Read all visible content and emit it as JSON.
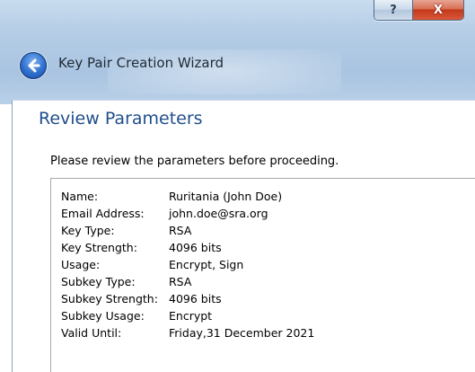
{
  "window": {
    "help_button": "?",
    "close_button": "X"
  },
  "header": {
    "wizard_title": "Key Pair Creation Wizard"
  },
  "page": {
    "section_title": "Review Parameters",
    "instruction": "Please review the parameters before proceeding."
  },
  "params": [
    {
      "label": "Name:",
      "value": "Ruritania (John Doe)"
    },
    {
      "label": "Email Address:",
      "value": "john.doe@sra.org"
    },
    {
      "label": "Key Type:",
      "value": "RSA"
    },
    {
      "label": "Key Strength:",
      "value": "4096 bits"
    },
    {
      "label": "Usage:",
      "value": "Encrypt, Sign"
    },
    {
      "label": "Subkey Type:",
      "value": "RSA"
    },
    {
      "label": "Subkey Strength:",
      "value": "4096 bits"
    },
    {
      "label": "Subkey Usage:",
      "value": "Encrypt"
    },
    {
      "label": "Valid Until:",
      "value": "Friday,31 December 2021"
    }
  ],
  "icons": {
    "back": "back-arrow-icon",
    "help": "question-mark-icon",
    "close": "close-x-icon"
  },
  "colors": {
    "title_bar": "#b5cde6",
    "section_title": "#1f4e8c",
    "close_button": "#c3391a"
  }
}
